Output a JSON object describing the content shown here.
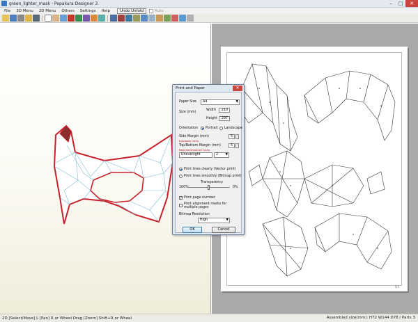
{
  "window": {
    "title": "green_lighter_mask - Pepakura Designer 3",
    "minimize": "–",
    "maximize": "□",
    "close": "✕"
  },
  "menu": {
    "items": [
      "File",
      "3D Menu",
      "2D Menu",
      "Others",
      "Settings",
      "Help"
    ],
    "undo_unfold": "Undo Unfold",
    "auto": "Auto"
  },
  "toolbar": {
    "icons": [
      "open-icon",
      "save-icon",
      "print-icon",
      "help-icon",
      "3d-view-icon",
      "select-icon",
      "hand-icon",
      "rotate-icon",
      "edge-icon",
      "fold-icon",
      "flap-icon",
      "texture-icon",
      "color-icon",
      "layout-icon",
      "join-icon",
      "split-icon",
      "move-icon",
      "zoom-icon",
      "grid-icon",
      "number-icon",
      "flip-icon",
      "text-icon",
      "image-icon",
      "page-icon"
    ]
  },
  "dialog": {
    "title": "Print and Paper",
    "close": "✕",
    "paper_size_label": "Paper Size",
    "paper_size_value": "A4",
    "size_mm_label": "Size (mm)",
    "width_label": "Width",
    "width_value": "210",
    "height_label": "Height",
    "height_value": "297",
    "orientation_label": "Orientation",
    "portrait_label": "Portrait",
    "landscape_label": "Landscape",
    "side_margin_label": "Side Margin (mm)",
    "side_margin_value": "5",
    "side_margin_note": "Боковые поля",
    "top_bottom_margin_label": "Top/Bottom Margin (mm)",
    "top_bottom_margin_value": "5",
    "top_bottom_margin_note": "Верхнее/нижнее поля",
    "uneven_select": "Unevenight",
    "uneven_value": "2",
    "print_clearly_label": "Print lines clearly (Vector print)",
    "print_smooth_label": "Print lines smoothly (Bitmap print)",
    "transparency_label": "Transparency",
    "transparency_min": "100%",
    "transparency_max": "0%",
    "print_page_number_label": "Print page number",
    "print_alignment_label": "Print alignment marks for multiple pages",
    "bitmap_resolution_label": "Bitmap Resolution",
    "bitmap_resolution_value": "High",
    "ok_label": "OK",
    "cancel_label": "Cancel"
  },
  "paper": {
    "page_number": "1/1"
  },
  "status": {
    "hint": "2D [Select/Move] L [Pan] R or Wheel Drag [Zoom] Shift+R or Wheel",
    "assembled": "Assembled size(mm): H72 W144 D78 / Parts 3"
  },
  "colors": {
    "mask_fill": "#ffffff",
    "mask_edges": "#c8202a",
    "mesh_lines": "#7fbcd4",
    "paper_bg": "#a9a9a9",
    "accent": "#3b78c4"
  }
}
